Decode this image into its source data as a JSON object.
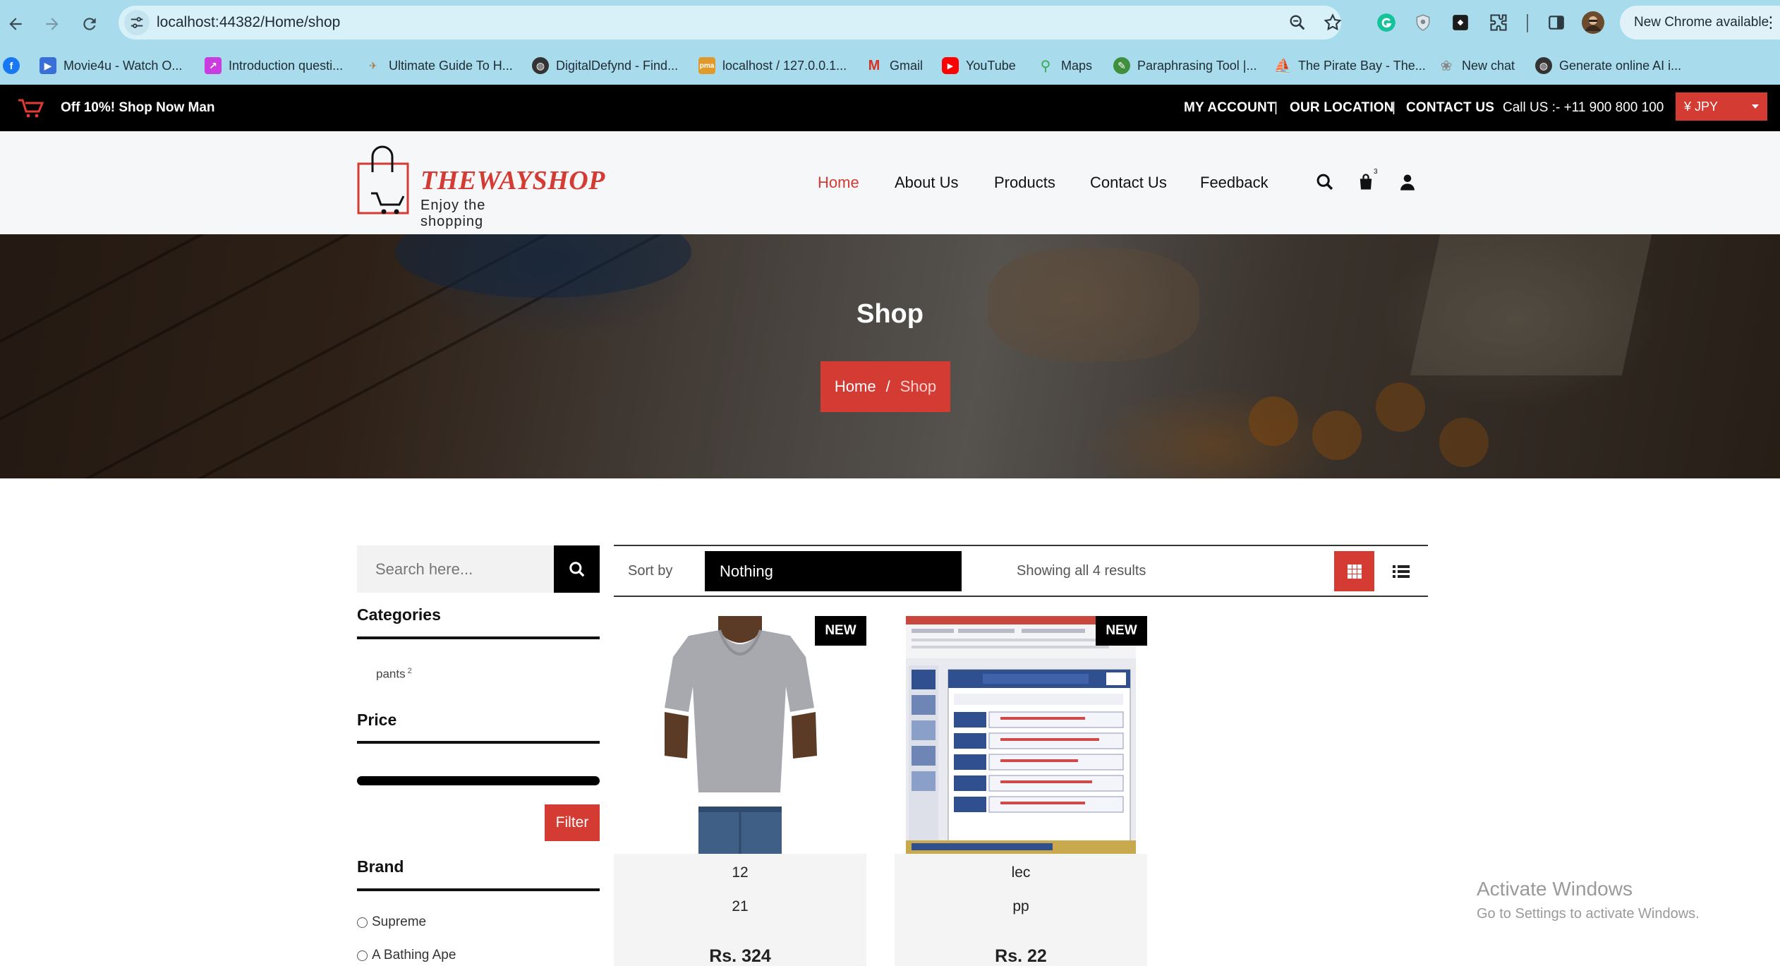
{
  "browser": {
    "url": "localhost:44382/Home/shop",
    "new_chrome_label": "New Chrome available",
    "bookmarks": [
      {
        "label": "Movie4u - Watch O...",
        "icon": "play-icon",
        "color": "#3b6fd8"
      },
      {
        "label": "Introduction questi...",
        "icon": "chart-icon",
        "color": "#c83ce0"
      },
      {
        "label": "Ultimate Guide To H...",
        "icon": "plane-icon",
        "color": "#b0753a"
      },
      {
        "label": "DigitalDefynd - Find...",
        "icon": "globe-icon",
        "color": "#333333"
      },
      {
        "label": "localhost / 127.0.0.1...",
        "icon": "pma-icon",
        "color": "#e09a2c"
      },
      {
        "label": "Gmail",
        "icon": "gmail-icon",
        "color": "#d93025"
      },
      {
        "label": "YouTube",
        "icon": "youtube-icon",
        "color": "#ff0000"
      },
      {
        "label": "Maps",
        "icon": "maps-icon",
        "color": "#34a853"
      },
      {
        "label": "Paraphrasing Tool |...",
        "icon": "quill-icon",
        "color": "#3f8f3f"
      },
      {
        "label": "The Pirate Bay - The...",
        "icon": "ship-icon",
        "color": "#8a6a4a"
      },
      {
        "label": "New chat",
        "icon": "chatgpt-icon",
        "color": "#888888"
      },
      {
        "label": "Generate online AI i...",
        "icon": "globe-icon",
        "color": "#333333"
      }
    ]
  },
  "topbar": {
    "promo": "Off 10%! Shop Now Man",
    "links": {
      "account": "MY ACCOUNT",
      "location": "OUR LOCATION",
      "contact": "CONTACT US"
    },
    "separator": "|",
    "call": "Call US :- +11 900 800 100",
    "currency": "¥ JPY"
  },
  "header": {
    "logo_title": "THEWAYSHOP",
    "logo_tagline": "Enjoy the shopping",
    "nav": {
      "home": "Home",
      "about": "About Us",
      "products": "Products",
      "contact": "Contact Us",
      "feedback": "Feedback"
    },
    "cart_count": "3"
  },
  "hero": {
    "title": "Shop",
    "breadcrumb": {
      "home": "Home",
      "separator": "/",
      "current": "Shop"
    }
  },
  "sidebar": {
    "search_placeholder": "Search here...",
    "categories_title": "Categories",
    "category": {
      "name": "pants",
      "count": "2"
    },
    "price_title": "Price",
    "filter_label": "Filter",
    "brand_title": "Brand",
    "brands": [
      "Supreme",
      "A Bathing Ape"
    ]
  },
  "toolbar": {
    "sort_label": "Sort by",
    "sort_value": "Nothing",
    "results": "Showing all 4 results"
  },
  "products": [
    {
      "badge": "NEW",
      "name": "12",
      "desc": "21",
      "price": "Rs. 324"
    },
    {
      "badge": "NEW",
      "name": "lec",
      "desc": "pp",
      "price": "Rs. 22"
    }
  ],
  "watermark": {
    "title": "Activate Windows",
    "subtitle": "Go to Settings to activate Windows."
  },
  "colors": {
    "brand_red": "#d33b33",
    "chrome_bar": "#a8dcec"
  }
}
